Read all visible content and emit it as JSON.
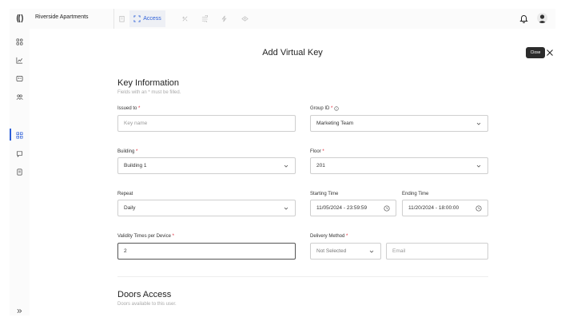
{
  "app": {
    "title": "Riverside Apartments"
  },
  "topnav": {
    "active_tab_label": "Access"
  },
  "page": {
    "title": "Add Virtual Key",
    "close_tooltip": "Close"
  },
  "key_info": {
    "title": "Key Information",
    "hint": "Fields with an * must be filled.",
    "issued_to": {
      "label": "Issued to",
      "required_mark": "*",
      "placeholder": "Key name",
      "value": ""
    },
    "group_id": {
      "label": "Group ID",
      "required_mark": "*",
      "value": "Marketing Team"
    },
    "building": {
      "label": "Building",
      "required_mark": "*",
      "value": "Building 1"
    },
    "floor": {
      "label": "Floor",
      "required_mark": "*",
      "value": "201"
    },
    "repeat": {
      "label": "Repeat",
      "value": "Daily"
    },
    "starting_time": {
      "label": "Starting Time",
      "value": "11/05/2024 - 23:59:59"
    },
    "ending_time": {
      "label": "Ending Time",
      "value": "11/20/2024 - 18:00:00"
    },
    "validity": {
      "label": "Validity Times per Device",
      "required_mark": "*",
      "value": "2"
    },
    "delivery": {
      "label": "Delivery Method",
      "required_mark": "*",
      "method_value": "Not Selected",
      "email_placeholder": "Email"
    }
  },
  "doors": {
    "title": "Doors Access",
    "hint": "Doors available to this user."
  },
  "icons": {
    "logo": "logo-icon",
    "bell": "bell-icon",
    "avatar": "user-avatar-icon",
    "chevron": "chevron-down-icon",
    "clock": "clock-icon",
    "close": "close-icon",
    "expand": "double-chevron-right-icon",
    "info": "info-icon"
  },
  "colors": {
    "accent": "#2d5fd8",
    "required": "#dd2233",
    "tooltip_bg": "#2b2b2b"
  }
}
